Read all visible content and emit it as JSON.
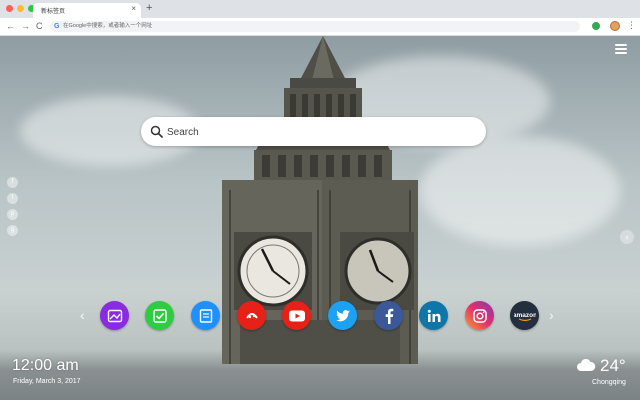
{
  "browser": {
    "tab_title": "新标签页",
    "tab_close": "×",
    "new_tab": "+",
    "back": "←",
    "forward": "→",
    "reload": "C",
    "omnibox_g": "G",
    "omnibox_placeholder": "在Google中搜索，或者输入一个网址",
    "menu": "⋮"
  },
  "search": {
    "placeholder": "Search"
  },
  "social_side": [
    "f",
    "t",
    "p",
    "g"
  ],
  "side_toggle": "‹",
  "app_arrows": {
    "left": "‹",
    "right": "›"
  },
  "apps": [
    {
      "name": "wallpaper",
      "color": "#8a2be2"
    },
    {
      "name": "todo",
      "color": "#2ecc40"
    },
    {
      "name": "notes",
      "color": "#1e90ff"
    },
    {
      "name": "games",
      "color": "#e62117"
    },
    {
      "name": "youtube",
      "color": "#e62117"
    },
    {
      "name": "twitter",
      "color": "#1da1f2"
    },
    {
      "name": "facebook",
      "color": "#3b5998"
    },
    {
      "name": "linkedin",
      "color": "#0e76a8"
    },
    {
      "name": "instagram",
      "color": "#c13584"
    },
    {
      "name": "amazon",
      "color": "#232f3e"
    }
  ],
  "clock": {
    "time": "12:00 am",
    "date": "Friday, March 3, 2017"
  },
  "weather": {
    "temp": "24°",
    "city": "Chongqing"
  }
}
